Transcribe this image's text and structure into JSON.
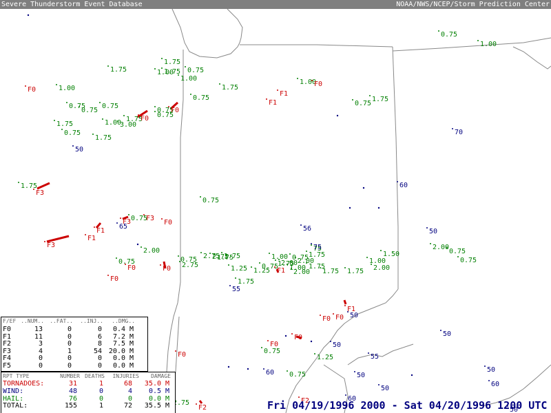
{
  "header": {
    "left_title": "Severe Thunderstorm Event Database",
    "right_title": "NOAA/NWS/NCEP/Storm Prediction Center"
  },
  "period_label": "Fri 04/19/1996 2000 - Sat 04/20/1996 1200 UTC",
  "colors": {
    "tornado": "#cc0000",
    "hail": "#007f00",
    "wind": "#00007f",
    "boundary": "#888888"
  },
  "fscale_table": {
    "headers": [
      "F/EF",
      "..NUM..",
      "..FAT..",
      "..INJ..",
      "..DMG.."
    ],
    "rows": [
      {
        "f": "F0",
        "num": "13",
        "fat": "0",
        "inj": "0",
        "dmg": "0.4",
        "unit": "M"
      },
      {
        "f": "F1",
        "num": "11",
        "fat": "0",
        "inj": "6",
        "dmg": "7.2",
        "unit": "M"
      },
      {
        "f": "F2",
        "num": "3",
        "fat": "0",
        "inj": "8",
        "dmg": "7.5",
        "unit": "M"
      },
      {
        "f": "F3",
        "num": "4",
        "fat": "1",
        "inj": "54",
        "dmg": "20.0",
        "unit": "M"
      },
      {
        "f": "F4",
        "num": "0",
        "fat": "0",
        "inj": "0",
        "dmg": "0.0",
        "unit": "M"
      },
      {
        "f": "F5",
        "num": "0",
        "fat": "0",
        "inj": "0",
        "dmg": "0.0",
        "unit": "M"
      }
    ]
  },
  "summary_table": {
    "headers": [
      "RPT TYPE",
      "NUMBER",
      "DEATHS",
      "INJURIES",
      "DAMAGE"
    ],
    "rows": [
      {
        "type": "TORNADOES:",
        "number": "31",
        "deaths": "1",
        "injuries": "68",
        "damage": "35.0",
        "unit": "M",
        "color": "#cc0000"
      },
      {
        "type": "WIND:",
        "number": "48",
        "deaths": "0",
        "injuries": "4",
        "damage": "0.5",
        "unit": "M",
        "color": "#00007f"
      },
      {
        "type": "HAIL:",
        "number": "76",
        "deaths": "0",
        "injuries": "0",
        "damage": "0.0",
        "unit": "M",
        "color": "#007f00"
      },
      {
        "type": "TOTAL:",
        "number": "155",
        "deaths": "1",
        "injuries": "72",
        "damage": "35.5",
        "unit": "M",
        "color": "#000000"
      }
    ]
  },
  "reports": {
    "hail": [
      {
        "label": "1.00"
      },
      {
        "label": "1.00"
      },
      {
        "label": "0.75"
      },
      {
        "label": "1.75"
      },
      {
        "label": "1.75"
      },
      {
        "label": "0.75"
      },
      {
        "label": "1.00"
      },
      {
        "label": "1.75"
      },
      {
        "label": "0.75"
      },
      {
        "label": "0.75"
      },
      {
        "label": "0.75"
      },
      {
        "label": "0.75"
      },
      {
        "label": "1.00"
      },
      {
        "label": "3.00"
      },
      {
        "label": "1.75"
      },
      {
        "label": "1.00"
      },
      {
        "label": "0.75"
      },
      {
        "label": "1.75"
      },
      {
        "label": "0.75"
      },
      {
        "label": "1.75"
      },
      {
        "label": "1.75"
      },
      {
        "label": "0.75"
      },
      {
        "label": "1.75"
      },
      {
        "label": "0.75"
      },
      {
        "label": "0.75"
      },
      {
        "label": "1.75"
      },
      {
        "label": "0.75"
      },
      {
        "label": "0.75"
      },
      {
        "label": "2.00"
      },
      {
        "label": "0.75"
      },
      {
        "label": "2.75"
      },
      {
        "label": "2.75"
      },
      {
        "label": "2.75"
      },
      {
        "label": "1.25"
      },
      {
        "label": "1.75"
      },
      {
        "label": "1.00"
      },
      {
        "label": "0.75"
      },
      {
        "label": "1.25"
      },
      {
        "label": "1.75"
      },
      {
        "label": "2.00"
      },
      {
        "label": "0.75"
      },
      {
        "label": "1.00"
      },
      {
        "label": "2.00"
      },
      {
        "label": "2.00"
      },
      {
        "label": "1.75"
      },
      {
        "label": "1.00"
      },
      {
        "label": "1.75"
      },
      {
        "label": "2.00"
      },
      {
        "label": "1.75"
      },
      {
        "label": "1.75"
      },
      {
        "label": "1.75"
      },
      {
        "label": "1.75"
      },
      {
        "label": "1.50"
      },
      {
        "label": "1.00"
      },
      {
        "label": "2.00"
      },
      {
        "label": "0.75"
      },
      {
        "label": "0.75"
      },
      {
        "label": "0.75"
      },
      {
        "label": "1.25"
      },
      {
        "label": "0.75"
      },
      {
        "label": "2.75"
      },
      {
        "label": "75"
      }
    ],
    "wind": [
      {
        "label": "50"
      },
      {
        "label": "70"
      },
      {
        "label": "60"
      },
      {
        "label": "65"
      },
      {
        "label": "56"
      },
      {
        "label": "75"
      },
      {
        "label": "50"
      },
      {
        "label": "55"
      },
      {
        "label": "60"
      },
      {
        "label": "50"
      },
      {
        "label": "50"
      },
      {
        "label": "55"
      },
      {
        "label": "60"
      },
      {
        "label": "50"
      },
      {
        "label": "50"
      },
      {
        "label": "50"
      },
      {
        "label": "60"
      },
      {
        "label": "50"
      },
      {
        "label": "50"
      }
    ],
    "tornado": [
      {
        "label": "F0"
      },
      {
        "label": "F1"
      },
      {
        "label": "F1"
      },
      {
        "label": "F0"
      },
      {
        "label": "F0"
      },
      {
        "label": "F0"
      },
      {
        "label": "F3"
      },
      {
        "label": "F3"
      },
      {
        "label": "F3"
      },
      {
        "label": "F1"
      },
      {
        "label": "F1"
      },
      {
        "label": "F3"
      },
      {
        "label": "F0"
      },
      {
        "label": "F0"
      },
      {
        "label": "F0"
      },
      {
        "label": "F0"
      },
      {
        "label": "F0"
      },
      {
        "label": "F1"
      },
      {
        "label": "F1"
      },
      {
        "label": "F0"
      },
      {
        "label": "F0"
      },
      {
        "label": "F0"
      },
      {
        "label": "F0"
      },
      {
        "label": "F2"
      },
      {
        "label": "F2"
      }
    ]
  }
}
